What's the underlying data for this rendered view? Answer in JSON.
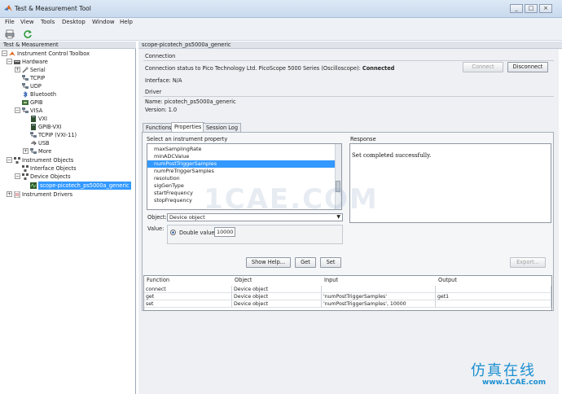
{
  "window": {
    "title": "Test & Measurement Tool",
    "controls": [
      "_",
      "□",
      "×"
    ]
  },
  "menu": [
    "File",
    "View",
    "Tools",
    "Desktop",
    "Window",
    "Help"
  ],
  "left": {
    "header": "Test & Measurement",
    "tree": [
      {
        "label": "Instrument Control Toolbox",
        "level": 0,
        "exp": "−",
        "icon": "toolbox-icon"
      },
      {
        "label": "Hardware",
        "level": 1,
        "exp": "−",
        "icon": "hardware-icon"
      },
      {
        "label": "Serial",
        "level": 2,
        "exp": "+",
        "icon": "serial-icon"
      },
      {
        "label": "TCPIP",
        "level": 2,
        "exp": "",
        "icon": "network-icon"
      },
      {
        "label": "UDP",
        "level": 2,
        "exp": "",
        "icon": "network-icon"
      },
      {
        "label": "Bluetooth",
        "level": 2,
        "exp": "",
        "icon": "bluetooth-icon"
      },
      {
        "label": "GPIB",
        "level": 2,
        "exp": "",
        "icon": "gpib-icon"
      },
      {
        "label": "VISA",
        "level": 2,
        "exp": "−",
        "icon": "visa-icon"
      },
      {
        "label": "VXI",
        "level": 3,
        "exp": "",
        "icon": "vxi-icon"
      },
      {
        "label": "GPIB-VXI",
        "level": 3,
        "exp": "",
        "icon": "vxi-icon"
      },
      {
        "label": "TCPIP (VXI-11)",
        "level": 3,
        "exp": "",
        "icon": "network-icon"
      },
      {
        "label": "USB",
        "level": 3,
        "exp": "",
        "icon": "usb-icon"
      },
      {
        "label": "More",
        "level": 3,
        "exp": "+",
        "icon": "network-icon"
      },
      {
        "label": "Instrument Objects",
        "level": 1,
        "exp": "−",
        "icon": "objects-icon"
      },
      {
        "label": "Interface Objects",
        "level": 2,
        "exp": "",
        "icon": "interface-icon"
      },
      {
        "label": "Device Objects",
        "level": 2,
        "exp": "−",
        "icon": "device-icon"
      },
      {
        "label": "scope-picotech_ps5000a_generic",
        "level": 3,
        "exp": "",
        "icon": "scope-icon",
        "selected": true
      },
      {
        "label": "Instrument Drivers",
        "level": 1,
        "exp": "+",
        "icon": "driver-icon"
      }
    ]
  },
  "right": {
    "header": "scope-picotech_ps5000a_generic",
    "connection": {
      "heading": "Connection",
      "status_prefix": "Connection status to Pico Technology Ltd. PicoScope 5000 Series (Oscilloscope):",
      "status_value": "Connected",
      "interface": "Interface: N/A",
      "connect_label": "Connect",
      "disconnect_label": "Disconnect"
    },
    "driver": {
      "heading": "Driver",
      "name": "Name:  picotech_ps5000a_generic",
      "version": "Version: 1.0"
    },
    "tabs": [
      "Functions",
      "Properties",
      "Session Log"
    ],
    "properties": {
      "select_label": "Select an instrument property",
      "items": [
        "maxSamplingRate",
        "minADCValue",
        "numPostTriggerSamples",
        "numPreTriggerSamples",
        "resolution",
        "sigGenType",
        "startFrequency",
        "stopFrequency"
      ],
      "selected_index": 2,
      "response_label": "Response",
      "response_text": "Set completed successfully.",
      "object_label": "Object:",
      "object_value": "Device object",
      "value_label": "Value:",
      "double_label": "Double value:",
      "double_value": "10000",
      "show_help": "Show Help...",
      "get": "Get",
      "set": "Set",
      "export": "Export..."
    },
    "history": {
      "columns": [
        "Function",
        "Object",
        "Input",
        "Output"
      ],
      "rows": [
        [
          "connect",
          "Device object",
          "",
          ""
        ],
        [
          "get",
          "Device object",
          "'numPostTriggerSamples'",
          "get1"
        ],
        [
          "set",
          "Device object",
          "'numPostTriggerSamples', 10000",
          ""
        ]
      ]
    }
  },
  "watermark": "1CAE.COM",
  "brand": {
    "cn": "仿真在线",
    "url": "www.1CAE.com"
  },
  "colors": {
    "selection": "#3399ff",
    "brand": "#1b8fd1"
  }
}
